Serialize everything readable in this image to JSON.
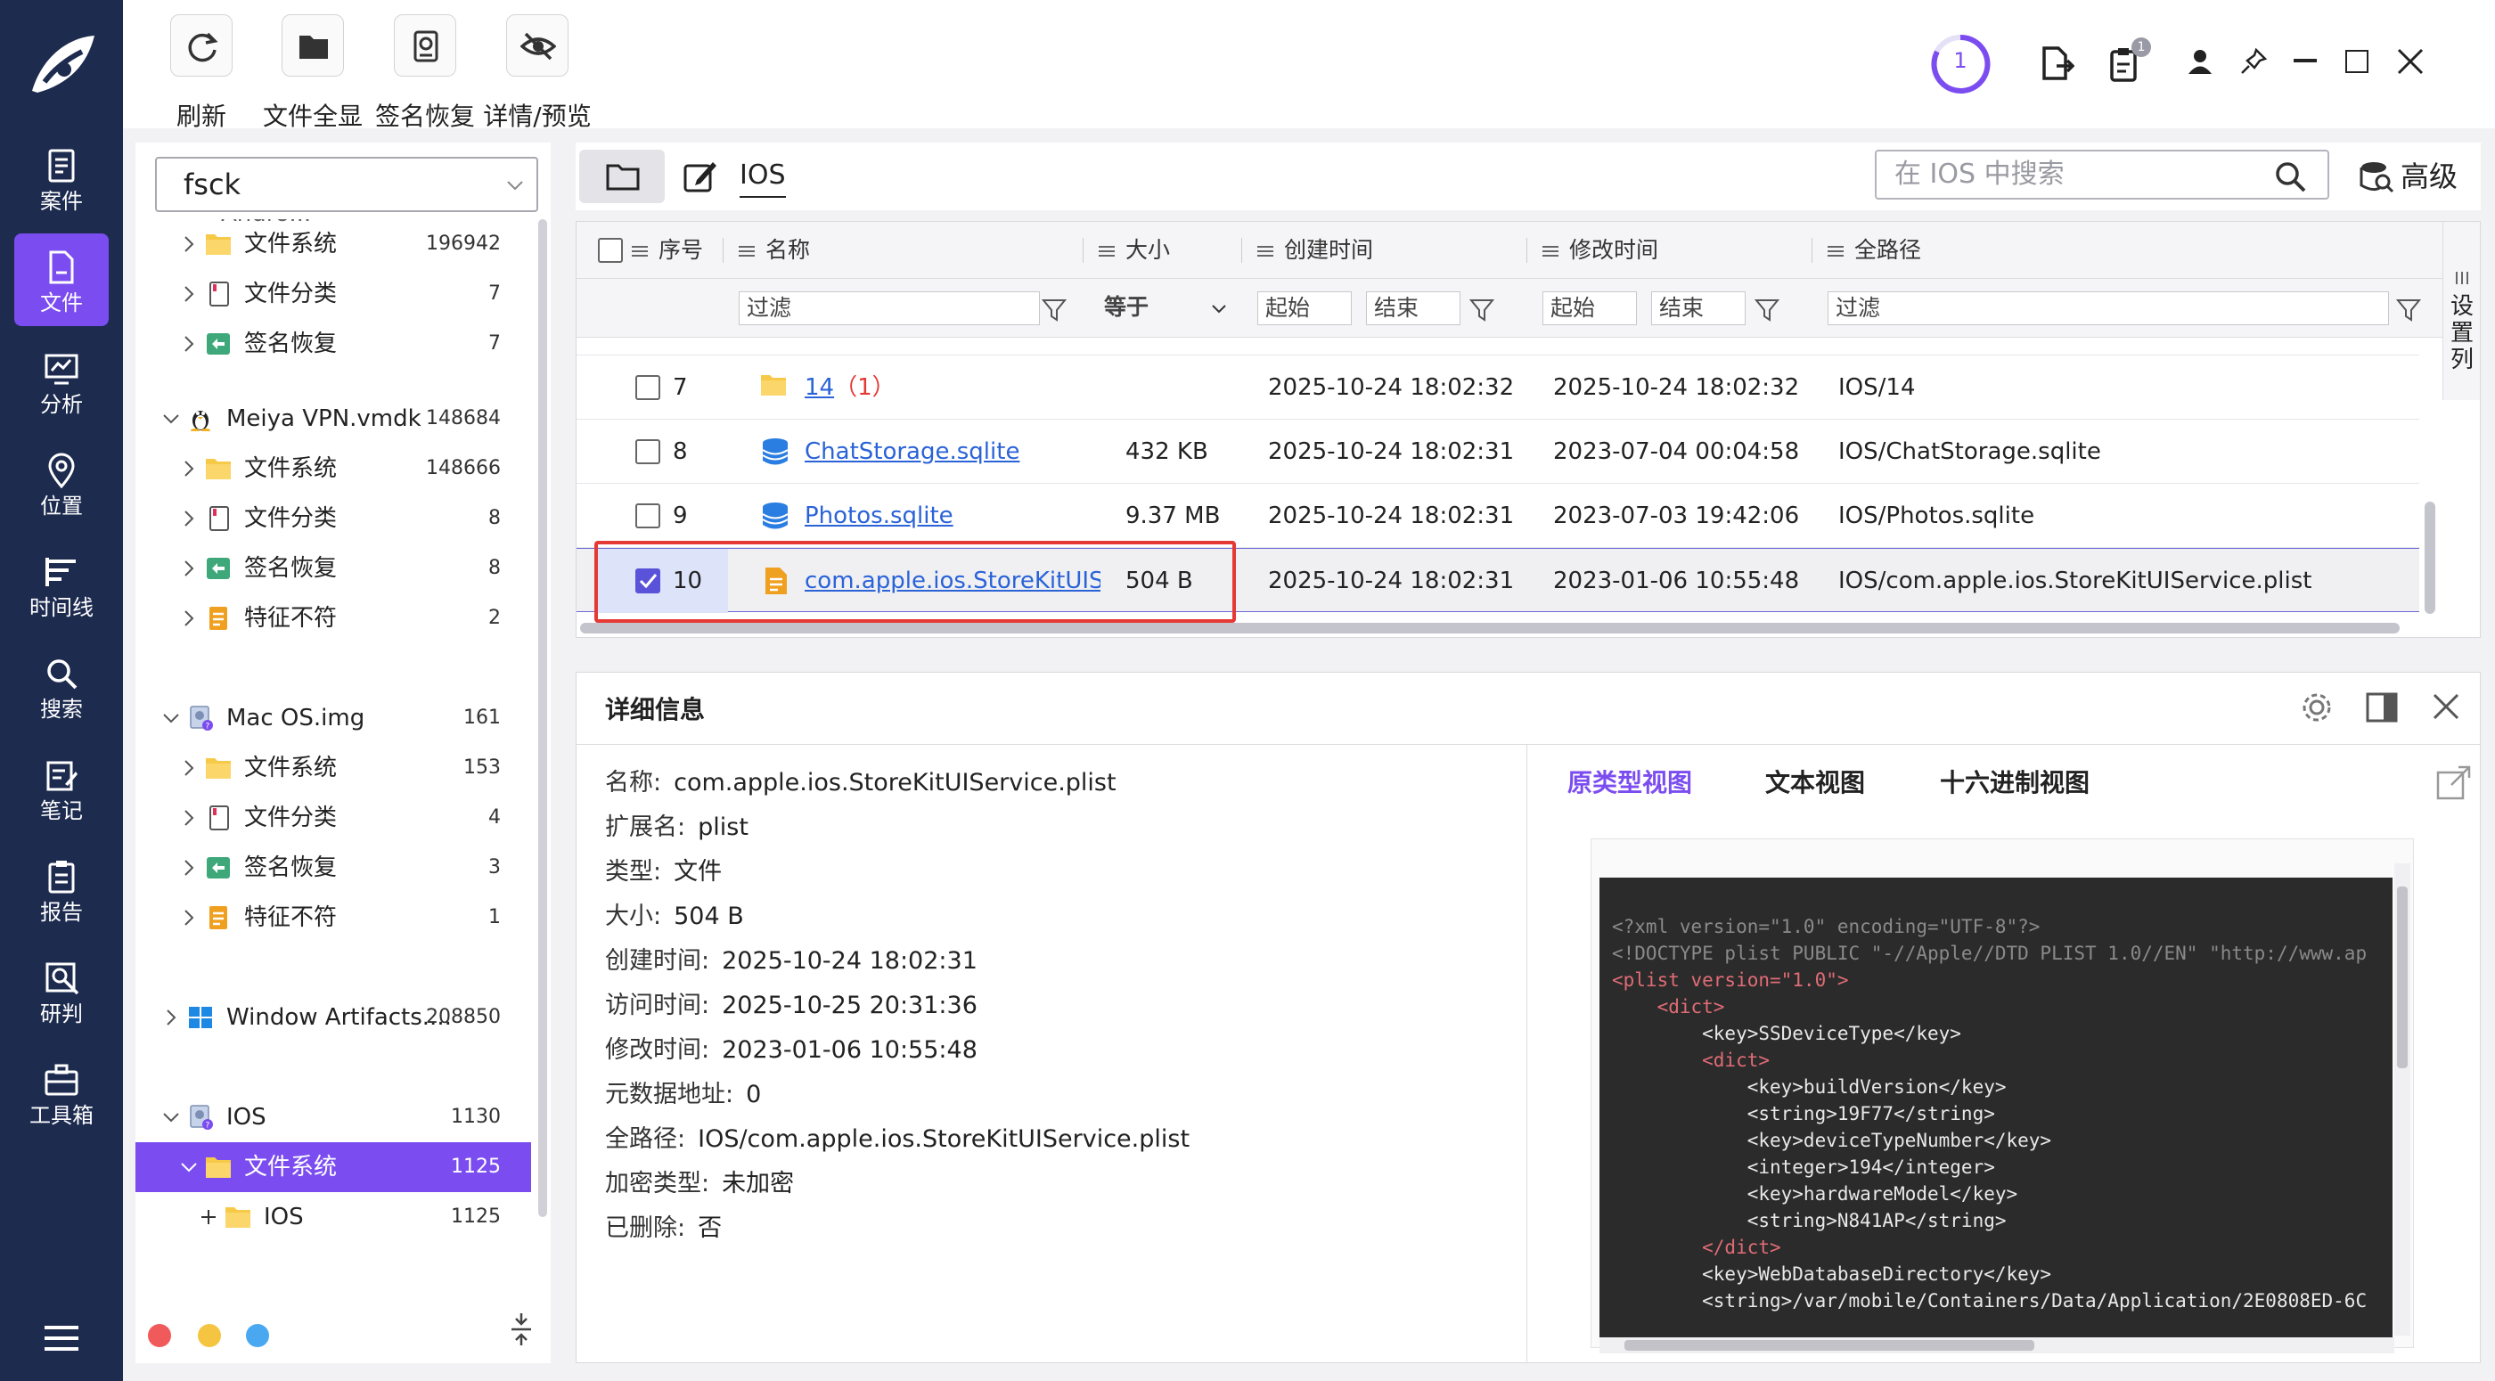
{
  "app": {
    "logo": "feather-logo-icon"
  },
  "rail": {
    "items": [
      {
        "label": "案件",
        "icon": "case-icon"
      },
      {
        "label": "文件",
        "icon": "file-icon",
        "active": true
      },
      {
        "label": "分析",
        "icon": "analysis-icon"
      },
      {
        "label": "位置",
        "icon": "location-icon"
      },
      {
        "label": "时间线",
        "icon": "timeline-icon"
      },
      {
        "label": "搜索",
        "icon": "search-icon"
      },
      {
        "label": "笔记",
        "icon": "note-icon"
      },
      {
        "label": "报告",
        "icon": "report-icon"
      },
      {
        "label": "研判",
        "icon": "judge-icon"
      },
      {
        "label": "工具箱",
        "icon": "toolbox-icon"
      }
    ]
  },
  "toolbar": {
    "refresh": "刷新",
    "show_all": "文件全显",
    "sig_recovery": "签名恢复",
    "detail_preview": "详情/预览",
    "progress_count": "1",
    "badge_count": "1"
  },
  "tree": {
    "source_select": "fsck",
    "cut_top_label": "Andro...",
    "rows": [
      {
        "label": "文件系统",
        "count": "196942",
        "icon": "folder-icon"
      },
      {
        "label": "文件分类",
        "count": "7",
        "icon": "category-icon"
      },
      {
        "label": "签名恢复",
        "count": "7",
        "icon": "signature-icon"
      },
      {
        "label": "Meiya VPN.vmdk",
        "count": "148684",
        "icon": "linux-icon"
      },
      {
        "label": "文件系统",
        "count": "148666",
        "icon": "folder-icon"
      },
      {
        "label": "文件分类",
        "count": "8",
        "icon": "category-icon"
      },
      {
        "label": "签名恢复",
        "count": "8",
        "icon": "signature-icon"
      },
      {
        "label": "特征不符",
        "count": "2",
        "icon": "mismatch-icon"
      },
      {
        "label": "Mac OS.img",
        "count": "161",
        "icon": "disk-icon"
      },
      {
        "label": "文件系统",
        "count": "153",
        "icon": "folder-icon"
      },
      {
        "label": "文件分类",
        "count": "4",
        "icon": "category-icon"
      },
      {
        "label": "签名恢复",
        "count": "3",
        "icon": "signature-icon"
      },
      {
        "label": "特征不符",
        "count": "1",
        "icon": "mismatch-icon"
      },
      {
        "label": "Window Artifacts....",
        "count": "208850",
        "icon": "windows-icon"
      },
      {
        "label": "IOS",
        "count": "1130",
        "icon": "disk-icon"
      },
      {
        "label": "文件系统",
        "count": "1125",
        "icon": "folder-icon",
        "selected": true
      },
      {
        "label": "IOS",
        "count": "1125",
        "icon": "folder-icon"
      }
    ],
    "footer_dots": [
      "#f15a5a",
      "#f5c542",
      "#4aa8f0"
    ]
  },
  "crumb": {
    "path": "IOS",
    "search_placeholder": "在 IOS 中搜索",
    "advanced": "高级"
  },
  "grid": {
    "columns": [
      "序号",
      "名称",
      "大小",
      "创建时间",
      "修改时间",
      "全路径"
    ],
    "filters": {
      "name": "过滤",
      "size_op": "等于",
      "created_start": "起始",
      "created_end": "结束",
      "modified_start": "起始",
      "modified_end": "结束",
      "path": "过滤"
    },
    "settings_label": "设置列",
    "rows": [
      {
        "index": "7",
        "name": "14",
        "suffix": "（1）",
        "size": "",
        "created": "2025-10-24 18:02:32",
        "modified": "2025-10-24 18:02:32",
        "path": "IOS/14",
        "icon": "folder-icon"
      },
      {
        "index": "8",
        "name": "ChatStorage.sqlite",
        "suffix": "",
        "size": "432 KB",
        "created": "2025-10-24 18:02:31",
        "modified": "2023-07-04 00:04:58",
        "path": "IOS/ChatStorage.sqlite",
        "icon": "database-icon"
      },
      {
        "index": "9",
        "name": "Photos.sqlite",
        "suffix": "",
        "size": "9.37 MB",
        "created": "2025-10-24 18:02:31",
        "modified": "2023-07-03 19:42:06",
        "path": "IOS/Photos.sqlite",
        "icon": "database-icon"
      },
      {
        "index": "10",
        "name": "com.apple.ios.StoreKitUIService.plist",
        "suffix": "",
        "size": "504 B",
        "created": "2025-10-24 18:02:31",
        "modified": "2023-01-06 10:55:48",
        "path": "IOS/com.apple.ios.StoreKitUIService.plist",
        "icon": "plist-icon",
        "checked": true,
        "selected": true
      }
    ]
  },
  "detail": {
    "title": "详细信息",
    "props": [
      {
        "k": "名称:",
        "v": "com.apple.ios.StoreKitUIService.plist"
      },
      {
        "k": "扩展名:",
        "v": "plist"
      },
      {
        "k": "类型:",
        "v": "文件"
      },
      {
        "k": "大小:",
        "v": "504 B"
      },
      {
        "k": "创建时间:",
        "v": "2025-10-24 18:02:31"
      },
      {
        "k": "访问时间:",
        "v": "2025-10-25 20:31:36"
      },
      {
        "k": "修改时间:",
        "v": "2023-01-06 10:55:48"
      },
      {
        "k": "元数据地址:",
        "v": "0"
      },
      {
        "k": "全路径:",
        "v": "IOS/com.apple.ios.StoreKitUIService.plist"
      },
      {
        "k": "加密类型:",
        "v": "未加密"
      },
      {
        "k": "已删除:",
        "v": "否"
      }
    ],
    "tabs": [
      "原类型视图",
      "文本视图",
      "十六进制视图"
    ],
    "code_lines": [
      {
        "t": "<?xml version=\"1.0\" encoding=\"UTF-8\"?>",
        "c": "#8a8a8a"
      },
      {
        "t": "<!DOCTYPE plist PUBLIC \"-//Apple//DTD PLIST 1.0//EN\" \"http://www.ap",
        "c": "#8a8a8a"
      },
      {
        "t": "<plist version=\"1.0\">",
        "c": "#e06c75"
      },
      {
        "t": "    <dict>",
        "c": "#e06c75"
      },
      {
        "t": "        <key>SSDeviceType</key>",
        "c": "#e8e8e8"
      },
      {
        "t": "        <dict>",
        "c": "#e06c75"
      },
      {
        "t": "            <key>buildVersion</key>",
        "c": "#e8e8e8"
      },
      {
        "t": "            <string>19F77</string>",
        "c": "#e8e8e8"
      },
      {
        "t": "            <key>deviceTypeNumber</key>",
        "c": "#e8e8e8"
      },
      {
        "t": "            <integer>194</integer>",
        "c": "#e8e8e8"
      },
      {
        "t": "            <key>hardwareModel</key>",
        "c": "#e8e8e8"
      },
      {
        "t": "            <string>N841AP</string>",
        "c": "#e8e8e8"
      },
      {
        "t": "        </dict>",
        "c": "#e06c75"
      },
      {
        "t": "        <key>WebDatabaseDirectory</key>",
        "c": "#e8e8e8"
      },
      {
        "t": "        <string>/var/mobile/Containers/Data/Application/2E0808ED-6C",
        "c": "#e8e8e8"
      }
    ]
  },
  "colors": {
    "accent": "#7b4df0",
    "rail": "#1d2b4f",
    "highlight_box": "#e53935",
    "link": "#2a63d8"
  }
}
